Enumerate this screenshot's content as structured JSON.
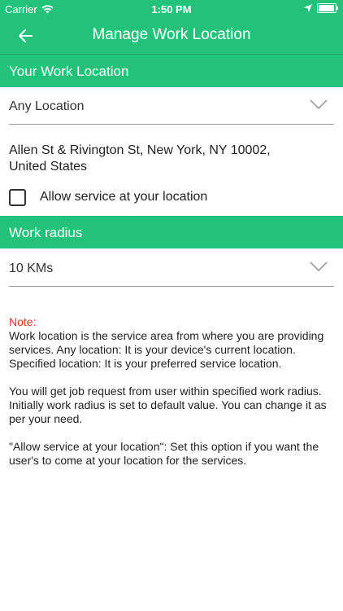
{
  "status_bar": {
    "carrier": "Carrier",
    "time": "1:50 PM",
    "battery_level": 0.95
  },
  "nav": {
    "title": "Manage Work Location",
    "back_icon": "arrow-left-icon"
  },
  "work_location": {
    "header": "Your Work Location",
    "selected": "Any Location",
    "address_line1": "Allen St & Rivington St,  New York,  NY 10002,",
    "address_line2": "United States",
    "allow_service_label": "Allow service at your location",
    "allow_service_checked": false
  },
  "work_radius": {
    "header": "Work radius",
    "selected": "10 KMs"
  },
  "note": {
    "title": "Note:",
    "lines1": [
      "Work location is the service area from where you are providing",
      "services. Any location: It is your device's current location.",
      "Specified location: It is your preferred service location."
    ],
    "lines2": [
      "You will get job request from user within specified work radius.",
      "Initially work radius is set to default value. You can change it as",
      "per your need."
    ],
    "lines3": [
      "\"Allow service at your location\": Set this option if you want the",
      "user's to come at your location for the services."
    ]
  },
  "colors": {
    "accent": "#22c27a",
    "note_title": "#e8332a"
  }
}
